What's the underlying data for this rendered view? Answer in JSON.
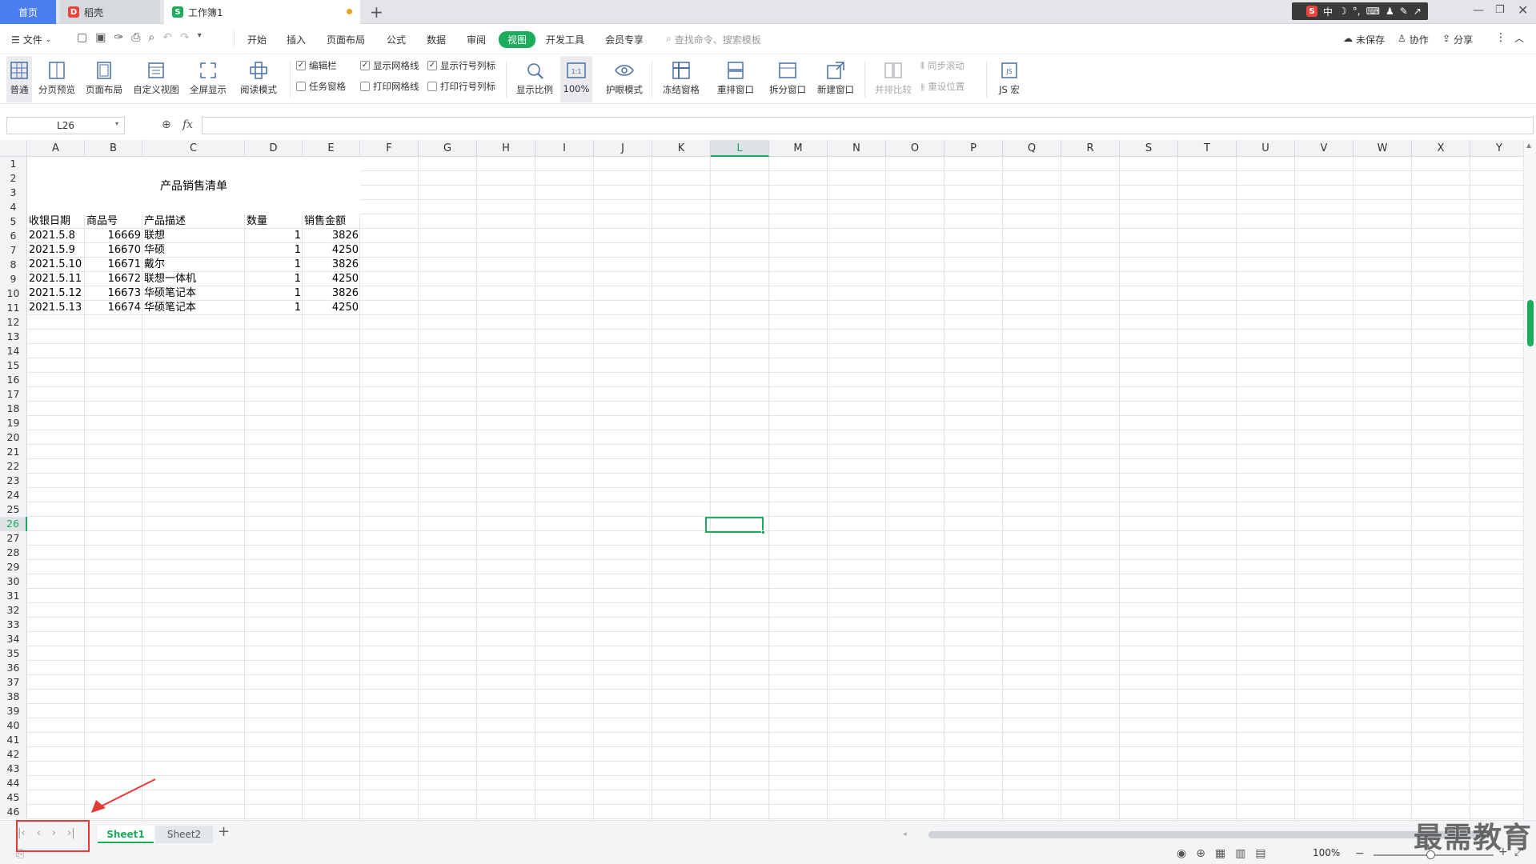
{
  "window": {
    "tabs": [
      {
        "label": "首页"
      },
      {
        "label": "稻壳"
      },
      {
        "label": "工作簿1"
      }
    ],
    "ime_label": "中"
  },
  "menu": {
    "file_label": "文件",
    "items": [
      "开始",
      "插入",
      "页面布局",
      "公式",
      "数据",
      "审阅",
      "视图",
      "开发工具",
      "会员专享"
    ],
    "active_item": "视图",
    "search_placeholder": "查找命令、搜索模板",
    "right": {
      "unsaved": "未保存",
      "collab": "协作",
      "share": "分享"
    }
  },
  "ribbon": {
    "buttons": [
      {
        "label": "普通"
      },
      {
        "label": "分页预览"
      },
      {
        "label": "页面布局"
      },
      {
        "label": "自定义视图"
      },
      {
        "label": "全屏显示"
      },
      {
        "label": "阅读模式"
      },
      {
        "label": "显示比例"
      },
      {
        "label": "100%"
      },
      {
        "label": "护眼模式"
      },
      {
        "label": "冻结窗格"
      },
      {
        "label": "重排窗口"
      },
      {
        "label": "拆分窗口"
      },
      {
        "label": "新建窗口"
      },
      {
        "label": "并排比较"
      },
      {
        "label": "JS 宏"
      }
    ],
    "checkboxes": [
      {
        "label": "编辑栏",
        "checked": true
      },
      {
        "label": "任务窗格",
        "checked": false
      },
      {
        "label": "显示网格线",
        "checked": true
      },
      {
        "label": "打印网格线",
        "checked": false
      },
      {
        "label": "显示行号列标",
        "checked": true
      },
      {
        "label": "打印行号列标",
        "checked": false
      }
    ],
    "disabled_small": [
      {
        "label": "同步滚动"
      },
      {
        "label": "重设位置"
      }
    ]
  },
  "formula_bar": {
    "name_box": "L26",
    "fx": "fx",
    "formula": ""
  },
  "sheet": {
    "columns": [
      "A",
      "B",
      "C",
      "D",
      "E",
      "F",
      "G",
      "H",
      "I",
      "J",
      "K",
      "L",
      "M",
      "N",
      "O",
      "P",
      "Q",
      "R",
      "S",
      "T",
      "U",
      "V",
      "W",
      "X",
      "Y"
    ],
    "selected_column": "L",
    "selected_row": 26,
    "visible_rows": 46,
    "title": "产品销售清单",
    "headers": [
      "收银日期",
      "商品号",
      "产品描述",
      "数量",
      "销售金额"
    ],
    "rows": [
      [
        "2021.5.8",
        "16669",
        "联想",
        "1",
        "3826"
      ],
      [
        "2021.5.9",
        "16670",
        "华硕",
        "1",
        "4250"
      ],
      [
        "2021.5.10",
        "16671",
        "戴尔",
        "1",
        "3826"
      ],
      [
        "2021.5.11",
        "16672",
        "联想一体机",
        "1",
        "4250"
      ],
      [
        "2021.5.12",
        "16673",
        "华硕笔记本",
        "1",
        "3826"
      ],
      [
        "2021.5.13",
        "16674",
        "华硕笔记本",
        "1",
        "4250"
      ]
    ]
  },
  "sheet_tabs": [
    {
      "label": "Sheet1",
      "active": true
    },
    {
      "label": "Sheet2",
      "active": false
    }
  ],
  "status": {
    "zoom": "100%"
  },
  "watermark": "最需教育",
  "colors": {
    "accent": "#1bac5c",
    "home_tab": "#4a7ff0",
    "annotation": "#e53935"
  }
}
